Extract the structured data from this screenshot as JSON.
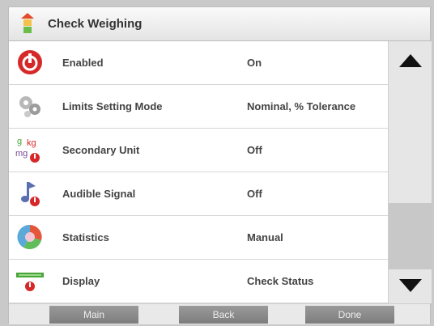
{
  "header": {
    "title": "Check Weighing",
    "icon": "traffic-light-icon"
  },
  "rows": [
    {
      "label": "Enabled",
      "value": "On",
      "icon": "power-icon"
    },
    {
      "label": "Limits Setting Mode",
      "value": "Nominal, % Tolerance",
      "icon": "gears-icon"
    },
    {
      "label": "Secondary Unit",
      "value": "Off",
      "icon": "units-g-kg-mg-icon"
    },
    {
      "label": "Audible Signal",
      "value": "Off",
      "icon": "music-note-icon"
    },
    {
      "label": "Statistics",
      "value": "Manual",
      "icon": "statistics-icon"
    },
    {
      "label": "Display",
      "value": "Check Status",
      "icon": "display-icon"
    }
  ],
  "scrollbar": {
    "up_icon": "arrow-up-icon",
    "down_icon": "arrow-down-icon"
  },
  "footer": {
    "main": "Main",
    "back": "Back",
    "done": "Done"
  },
  "colors": {
    "accent_red": "#d62828",
    "title_bg": "#ececec",
    "button": "#8c8c8c"
  }
}
